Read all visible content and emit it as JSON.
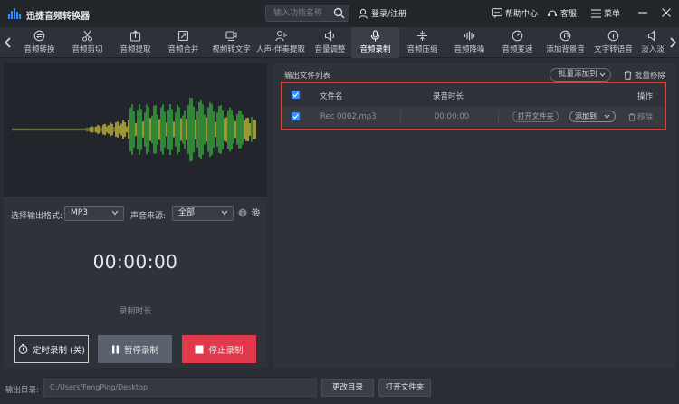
{
  "app": {
    "title": "迅捷音频转换器"
  },
  "search": {
    "placeholder": "输入功能名称"
  },
  "header": {
    "login": "登录/注册",
    "help": "帮助中心",
    "service": "客服",
    "menu": "菜单"
  },
  "toolbar": {
    "items": [
      {
        "label": "音频转换",
        "icon": "convert-icon"
      },
      {
        "label": "音频剪切",
        "icon": "scissors-icon"
      },
      {
        "label": "音频提取",
        "icon": "extract-icon"
      },
      {
        "label": "音频合并",
        "icon": "merge-icon"
      },
      {
        "label": "视频转文字",
        "icon": "video-text-icon"
      },
      {
        "label": "人声-伴奏提取",
        "icon": "vocal-icon"
      },
      {
        "label": "音量调整",
        "icon": "volume-icon"
      },
      {
        "label": "音频录制",
        "icon": "microphone-icon",
        "active": true
      },
      {
        "label": "音频压缩",
        "icon": "compress-icon"
      },
      {
        "label": "音频降噪",
        "icon": "denoise-icon"
      },
      {
        "label": "音频变速",
        "icon": "speed-icon"
      },
      {
        "label": "添加背景音",
        "icon": "bgm-icon"
      },
      {
        "label": "文字转语音",
        "icon": "tts-icon"
      },
      {
        "label": "淡入淡",
        "icon": "fade-icon"
      }
    ]
  },
  "recorder": {
    "format_label": "选择输出格式:",
    "format_value": "MP3",
    "source_label": "声音来源:",
    "source_value": "全部",
    "time": "00:00:00",
    "time_label": "录制时长",
    "timer_button": "定时录制 (关)",
    "pause_button": "暂停录制",
    "stop_button": "停止录制",
    "colors": {
      "stop": "#e0394b",
      "pause": "#5a6270",
      "wave_low": "#f0e03a",
      "wave_high": "#3ec43e"
    }
  },
  "output_list": {
    "title": "输出文件列表",
    "batch_add": "批量添加到",
    "batch_remove": "批量移除",
    "columns": {
      "name": "文件名",
      "duration": "录音时长",
      "action": "操作"
    },
    "rows": [
      {
        "name": "Rec 0002.mp3",
        "duration": "00:00:00",
        "open_folder": "打开文件夹",
        "add_to": "添加到",
        "remove": "移除"
      }
    ]
  },
  "footer": {
    "output_label": "输出目录:",
    "output_path": "C:/Users/FengPing/Desktop",
    "change_dir": "更改目录",
    "open_folder": "打开文件夹"
  }
}
